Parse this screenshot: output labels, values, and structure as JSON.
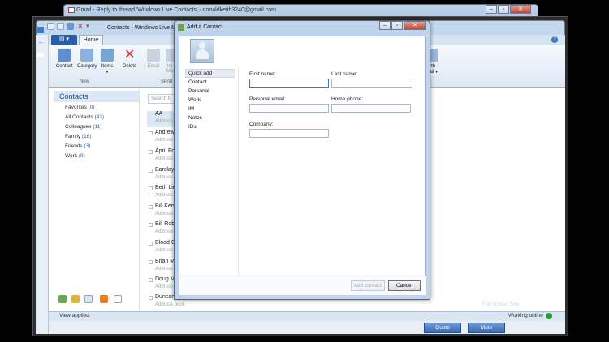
{
  "gmail_window": {
    "title": "Gmail - Reply to thread 'Windows Live Contacts' - donaldkeith3240@gmail.com"
  },
  "contacts_window": {
    "title": "Contacts - Windows Live M",
    "tabs": {
      "home": "Home"
    },
    "ribbon": {
      "buttons": [
        "Contact",
        "Category",
        "Items",
        "Delete",
        "Email",
        "Im",
        "Ma"
      ],
      "groups": {
        "new": "New",
        "send": "Send"
      },
      "items_arrow": "▾",
      "birthday": [
        "irth",
        "nail"
      ]
    },
    "sidebar": {
      "header": "Contacts",
      "categories": [
        {
          "label": "Favorites",
          "count": "(0)"
        },
        {
          "label": "All Contacts",
          "count": "(43)"
        },
        {
          "label": "Colleagues",
          "count": "(11)"
        },
        {
          "label": "Family",
          "count": "(16)"
        },
        {
          "label": "Friends",
          "count": "(3)"
        },
        {
          "label": "Work",
          "count": "(9)"
        }
      ]
    },
    "search": {
      "placeholder": "Search fi"
    },
    "contacts": [
      {
        "name": "AA",
        "sub": "Address"
      },
      {
        "name": "Andrew",
        "sub": "Address"
      },
      {
        "name": "April Fo",
        "sub": "Address"
      },
      {
        "name": "Barclay",
        "sub": "Address"
      },
      {
        "name": "Beth Lin",
        "sub": "Address"
      },
      {
        "name": "Bill Ken",
        "sub": "Address"
      },
      {
        "name": "Bill Rob",
        "sub": "Address"
      },
      {
        "name": "Blood G",
        "sub": "Address"
      },
      {
        "name": "Brian M",
        "sub": "Address"
      },
      {
        "name": "Doug M",
        "sub": "Address"
      },
      {
        "name": "Duncan",
        "sub": "Address book"
      }
    ],
    "status": {
      "text": "View applied.",
      "online": "Working online"
    },
    "behind": {
      "fullscreen": "Full screen Sno",
      "quote": "Quote",
      "mute": "Mute"
    }
  },
  "dialog": {
    "title": "Add a Contact",
    "nav": [
      "Quick add",
      "Contact",
      "Personal",
      "Work",
      "IM",
      "Notes",
      "IDs"
    ],
    "fields": {
      "first_name": {
        "label": "First name:",
        "value": ""
      },
      "last_name": {
        "label": "Last name:",
        "value": ""
      },
      "personal_email": {
        "label": "Personal email:",
        "value": ""
      },
      "home_phone": {
        "label": "Home phone:",
        "value": ""
      },
      "company": {
        "label": "Company:",
        "value": ""
      }
    },
    "buttons": {
      "add": "Add contact",
      "cancel": "Cancel"
    }
  },
  "colors": {
    "accent": "#2a5ea8",
    "window_frame": "#bfd4ec",
    "online": "#2c9a3b"
  }
}
